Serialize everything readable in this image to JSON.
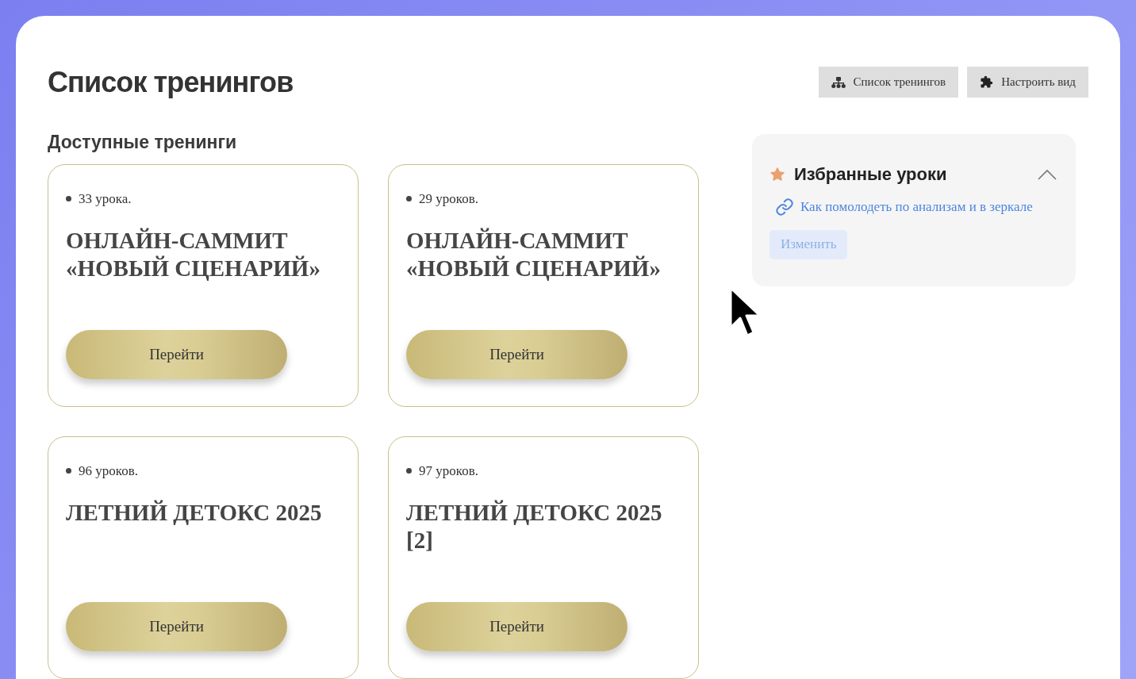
{
  "page": {
    "title": "Список тренингов"
  },
  "toolbar": {
    "buttons": [
      {
        "kind": "tree",
        "label": "Список тренингов"
      },
      {
        "kind": "puzzle",
        "label": "Настроить вид"
      }
    ]
  },
  "section": {
    "title": "Доступные тренинги"
  },
  "trainings": [
    {
      "count": "33 урока.",
      "title": "ОНЛАЙН-САММИТ «НОВЫЙ СЦЕНАРИЙ»",
      "button": "Перейти"
    },
    {
      "count": "29 уроков.",
      "title": "ОНЛАЙН-САММИТ «НОВЫЙ СЦЕНАРИЙ»",
      "button": "Перейти"
    },
    {
      "count": "96 уроков.",
      "title": "ЛЕТНИЙ ДЕТОКС 2025",
      "button": "Перейти"
    },
    {
      "count": "97 уроков.",
      "title": "ЛЕТНИЙ ДЕТОКС 2025 [2]",
      "button": "Перейти"
    }
  ],
  "favorites": {
    "title": "Избранные уроки",
    "expanded": true,
    "links": [
      "Как помолодеть по анализам и в зеркале"
    ],
    "edit_button": "Изменить"
  }
}
